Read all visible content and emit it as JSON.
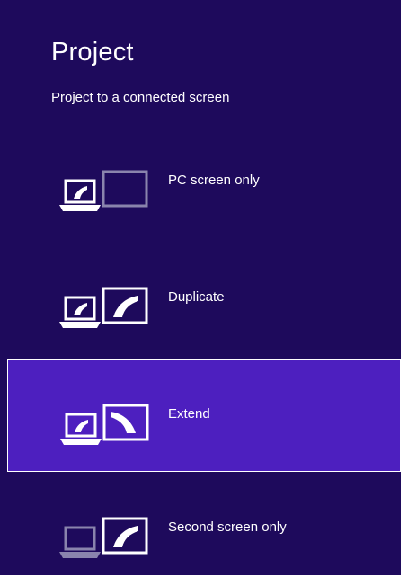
{
  "window": {
    "title": "Project",
    "subtitle": "Project to a connected screen"
  },
  "options": [
    {
      "label": "PC screen only",
      "icon": "pc-screen-only-icon",
      "selected": false
    },
    {
      "label": "Duplicate",
      "icon": "duplicate-icon",
      "selected": false
    },
    {
      "label": "Extend",
      "icon": "extend-icon",
      "selected": true
    },
    {
      "label": "Second screen only",
      "icon": "second-screen-only-icon",
      "selected": false
    }
  ],
  "colors": {
    "panel_background": "#1e0a5c",
    "selected_background": "#4d1fbf",
    "foreground": "#ffffff",
    "dimmed": "#8a84ad"
  }
}
